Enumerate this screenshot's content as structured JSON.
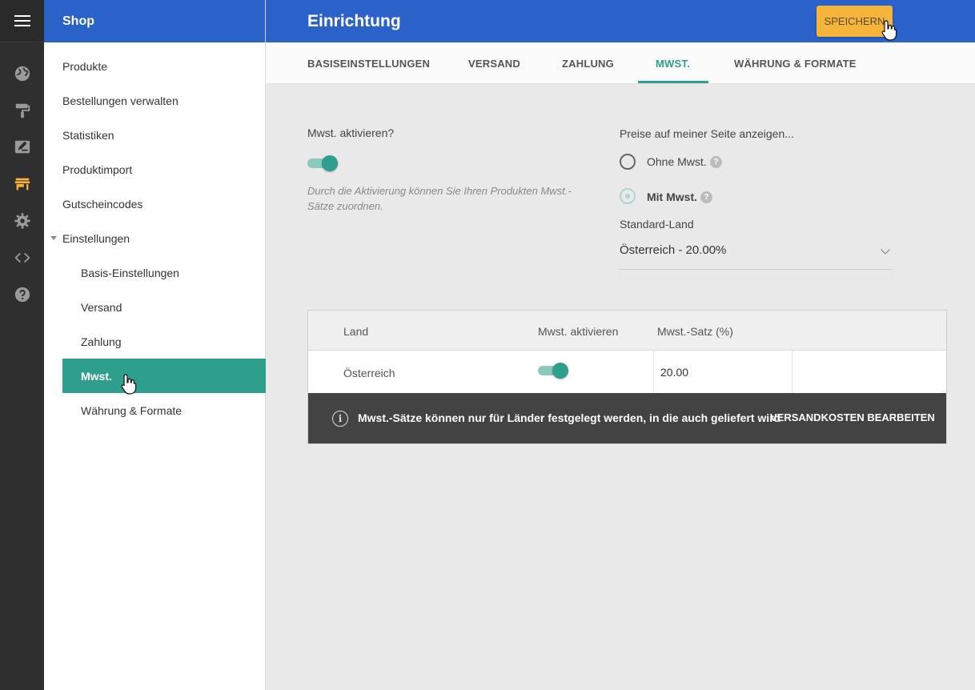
{
  "sidebar": {
    "title": "Shop",
    "items": [
      {
        "label": "Produkte"
      },
      {
        "label": "Bestellungen verwalten"
      },
      {
        "label": "Statistiken"
      },
      {
        "label": "Produktimport"
      },
      {
        "label": "Gutscheincodes"
      },
      {
        "label": "Einstellungen"
      },
      {
        "label": "Basis-Einstellungen"
      },
      {
        "label": "Versand"
      },
      {
        "label": "Zahlung"
      },
      {
        "label": "Mwst."
      },
      {
        "label": "Währung & Formate"
      }
    ]
  },
  "header": {
    "title": "Einrichtung",
    "save_label": "SPEICHERN"
  },
  "tabs": [
    {
      "label": "BASISEINSTELLUNGEN"
    },
    {
      "label": "VERSAND"
    },
    {
      "label": "ZAHLUNG"
    },
    {
      "label": "MWST."
    },
    {
      "label": "WÄHRUNG & FORMATE"
    }
  ],
  "vat": {
    "enable_label": "Mwst. aktivieren?",
    "enabled": true,
    "hint": "Durch die Aktivierung können Sie Ihren Produkten Mwst.-Sätze zuordnen.",
    "prices_label": "Preise auf meiner Seite anzeigen...",
    "option_without": "Ohne Mwst.",
    "option_with": "Mit Mwst.",
    "selected_option": "Mit Mwst.",
    "help_glyph": "?",
    "country_label": "Standard-Land",
    "country_value": "Österreich - 20.00%"
  },
  "table": {
    "headers": [
      "Land",
      "Mwst. aktivieren",
      "Mwst.-Satz (%)"
    ],
    "rows": [
      {
        "country": "Österreich",
        "enabled": true,
        "rate": "20.00"
      }
    ],
    "notice": "Mwst.-Sätze können nur für Länder festgelegt werden, in die auch geliefert wird",
    "notice_action": "VERSANDKOSTEN BEARBEITEN",
    "info_glyph": "i"
  },
  "colors": {
    "primary": "#2a62c9",
    "accent": "#2e9f8c",
    "save_button": "#f6b53a",
    "rail": "#2f2f2f",
    "rail_active_icon": "#f6b53a"
  },
  "rail_icons": [
    "menu-icon",
    "globe-icon",
    "paint-roller-icon",
    "edit-icon",
    "store-icon",
    "gear-icon",
    "code-icon",
    "help-icon"
  ]
}
